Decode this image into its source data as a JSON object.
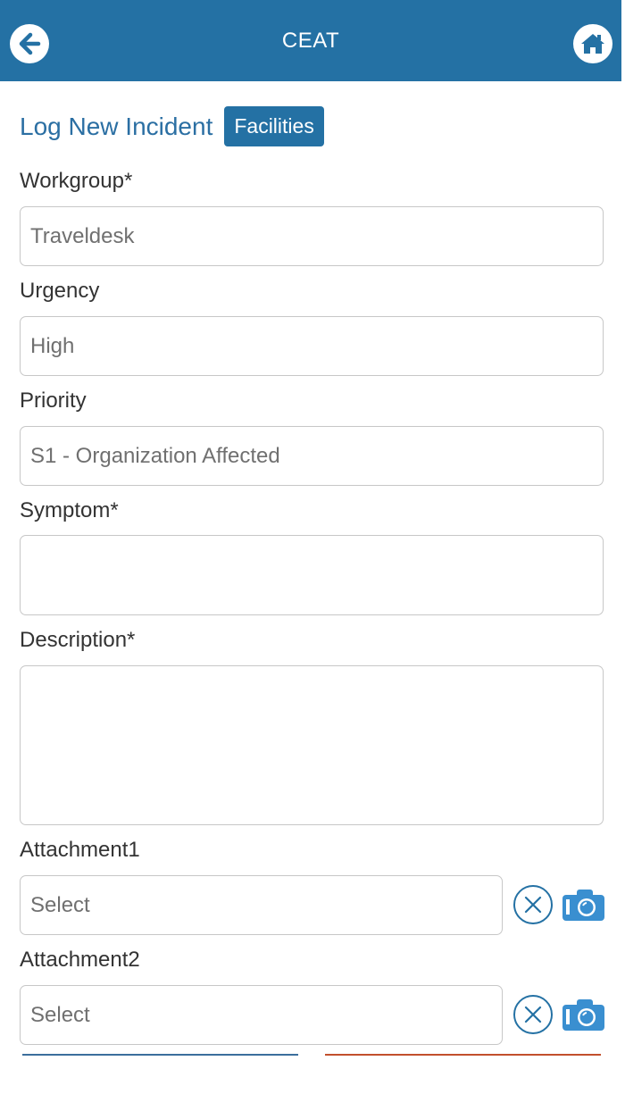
{
  "colors": {
    "accent": "#2471a4",
    "title": "#2b6fa3",
    "camera": "#3a8fd0",
    "submit_line": "#3b6e9c",
    "cancel_line": "#c2502d"
  },
  "header": {
    "title": "CEAT",
    "back_icon": "arrow-left-circle-icon",
    "home_icon": "home-icon"
  },
  "page": {
    "title": "Log New Incident",
    "category_badge": "Facilities"
  },
  "form": {
    "workgroup": {
      "label": "Workgroup*",
      "value": "Traveldesk"
    },
    "urgency": {
      "label": "Urgency",
      "value": "High"
    },
    "priority": {
      "label": "Priority",
      "value": "S1 - Organization Affected"
    },
    "symptom": {
      "label": "Symptom*",
      "value": ""
    },
    "description": {
      "label": "Description*",
      "value": ""
    },
    "attachment1": {
      "label": "Attachment1",
      "placeholder": "Select"
    },
    "attachment2": {
      "label": "Attachment2",
      "placeholder": "Select"
    }
  },
  "icons": {
    "clear": "close-circle-icon",
    "camera": "camera-icon"
  }
}
